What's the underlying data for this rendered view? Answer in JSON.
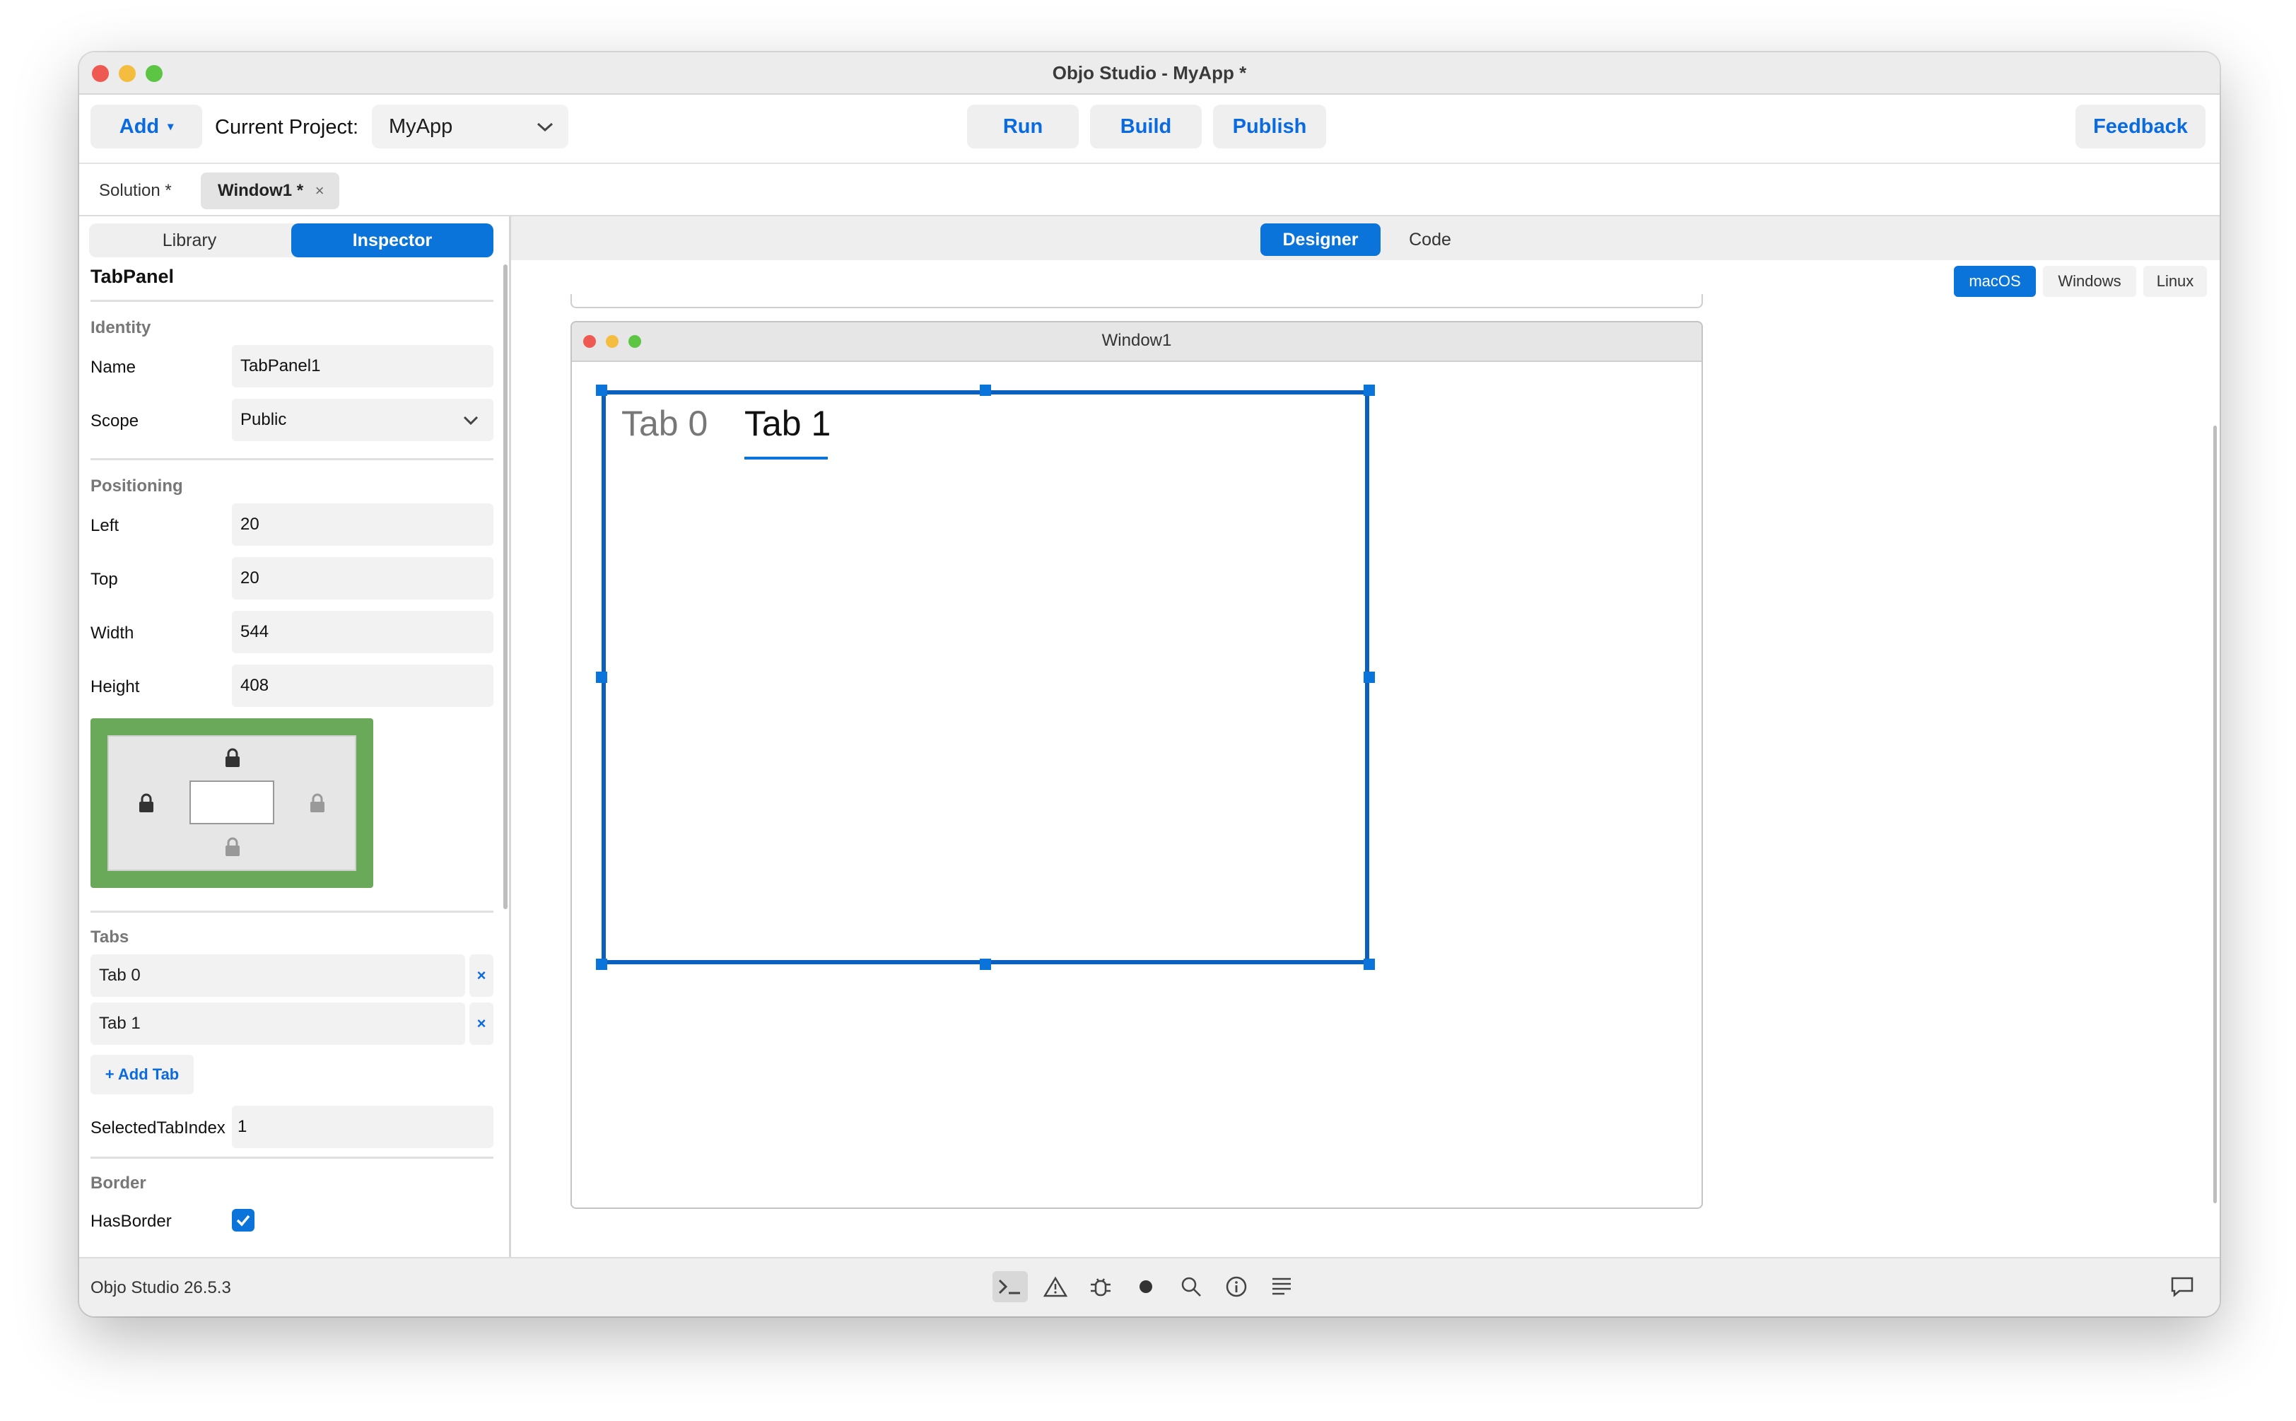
{
  "window": {
    "title": "Objo Studio - MyApp *"
  },
  "toolbar": {
    "add_label": "Add",
    "add_caret": "▾",
    "project_label": "Current Project:",
    "project_value": "MyApp",
    "run_label": "Run",
    "build_label": "Build",
    "publish_label": "Publish",
    "feedback_label": "Feedback"
  },
  "doc_tabs": [
    {
      "label": "Solution *"
    },
    {
      "label": "Window1 *",
      "close": "×"
    }
  ],
  "left_panel": {
    "tabs": [
      "Library",
      "Inspector"
    ],
    "active_tab": "Inspector",
    "heading": "TabPanel",
    "identity": {
      "title": "Identity",
      "name_label": "Name",
      "name_value": "TabPanel1",
      "scope_label": "Scope",
      "scope_value": "Public"
    },
    "positioning": {
      "title": "Positioning",
      "left_label": "Left",
      "left_value": "20",
      "top_label": "Top",
      "top_value": "20",
      "width_label": "Width",
      "width_value": "544",
      "height_label": "Height",
      "height_value": "408"
    },
    "tabs_section": {
      "title": "Tabs",
      "items": [
        {
          "label": "Tab 0",
          "remove": "×"
        },
        {
          "label": "Tab 1",
          "remove": "×"
        }
      ],
      "add_label": "+ Add Tab",
      "selected_label": "SelectedTabIndex",
      "selected_value": "1"
    },
    "border": {
      "title": "Border",
      "has_border_label": "HasBorder",
      "has_border": true
    }
  },
  "main": {
    "view_tabs": [
      "Designer",
      "Code"
    ],
    "active_view": "Designer",
    "platforms": [
      "macOS",
      "Windows",
      "Linux"
    ],
    "active_platform": "macOS",
    "design_window_title": "Window1",
    "tabpanel_tabs": [
      "Tab 0",
      "Tab 1"
    ],
    "tabpanel_selected": 1
  },
  "status": {
    "version": "Objo Studio 26.5.3"
  },
  "colors": {
    "accent": "#0a74da",
    "anchor_green": "#6aa95a",
    "red": "#ee5a52",
    "yellow": "#f4bd3f",
    "green": "#5cc543"
  }
}
